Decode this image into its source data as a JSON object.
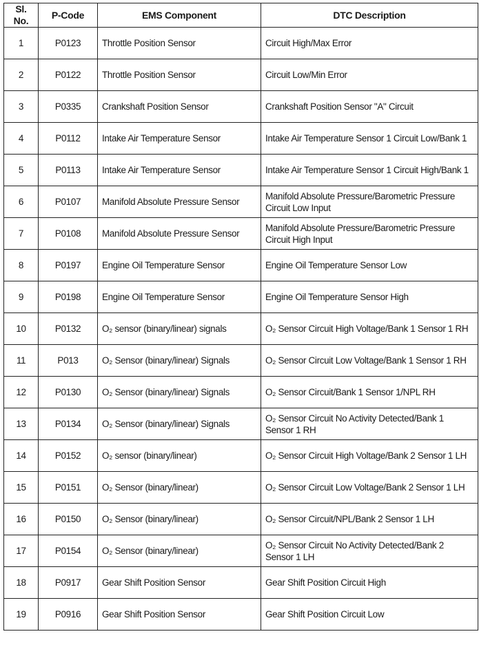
{
  "table": {
    "headers": [
      "Sl. No.",
      "P-Code",
      "EMS Component",
      "DTC Description"
    ],
    "rows": [
      {
        "no": "1",
        "code": "P0123",
        "component": "Throttle Position Sensor",
        "description": "Circuit High/Max Error"
      },
      {
        "no": "2",
        "code": "P0122",
        "component": "Throttle Position Sensor",
        "description": "Circuit Low/Min Error"
      },
      {
        "no": "3",
        "code": "P0335",
        "component": "Crankshaft Position Sensor",
        "description": "Crankshaft Position Sensor \"A\" Circuit"
      },
      {
        "no": "4",
        "code": "P0112",
        "component": "Intake Air Temperature Sensor",
        "description": "Intake Air Temperature Sensor 1 Circuit Low/Bank 1"
      },
      {
        "no": "5",
        "code": "P0113",
        "component": "Intake Air Temperature Sensor",
        "description": "Intake Air Temperature Sensor 1 Circuit High/Bank 1"
      },
      {
        "no": "6",
        "code": "P0107",
        "component": "Manifold Absolute Pressure Sensor",
        "description": "Manifold Absolute Pressure/Barometric Pressure Circuit Low Input"
      },
      {
        "no": "7",
        "code": "P0108",
        "component": "Manifold Absolute Pressure Sensor",
        "description": "Manifold Absolute Pressure/Barometric Pressure Circuit High Input"
      },
      {
        "no": "8",
        "code": "P0197",
        "component": "Engine Oil Temperature Sensor",
        "description": "Engine Oil Temperature Sensor Low"
      },
      {
        "no": "9",
        "code": "P0198",
        "component": "Engine Oil Temperature Sensor",
        "description": "Engine Oil Temperature Sensor High"
      },
      {
        "no": "10",
        "code": "P0132",
        "component": "O₂ sensor (binary/linear) signals",
        "description": "O₂ Sensor Circuit High Voltage/Bank 1 Sensor 1 RH"
      },
      {
        "no": "11",
        "code": "P013",
        "component": "O₂ Sensor (binary/linear) Signals",
        "description": "O₂ Sensor Circuit Low Voltage/Bank 1 Sensor 1 RH"
      },
      {
        "no": "12",
        "code": "P0130",
        "component": "O₂ Sensor (binary/linear) Signals",
        "description": "O₂ Sensor Circuit/Bank 1 Sensor 1/NPL RH"
      },
      {
        "no": "13",
        "code": "P0134",
        "component": "O₂ Sensor (binary/linear) Signals",
        "description": "O₂ Sensor Circuit No Activity Detected/Bank 1 Sensor 1 RH"
      },
      {
        "no": "14",
        "code": "P0152",
        "component": "O₂ sensor (binary/linear)",
        "description": "O₂ Sensor Circuit High Voltage/Bank 2 Sensor 1 LH"
      },
      {
        "no": "15",
        "code": "P0151",
        "component": "O₂  Sensor (binary/linear)",
        "description": "O₂ Sensor Circuit Low Voltage/Bank 2 Sensor 1 LH"
      },
      {
        "no": "16",
        "code": "P0150",
        "component": "O₂ Sensor (binary/linear)",
        "description": "O₂ Sensor Circuit/NPL/Bank 2 Sensor 1 LH"
      },
      {
        "no": "17",
        "code": "P0154",
        "component": "O₂ Sensor (binary/linear)",
        "description": "O₂ Sensor Circuit No Activity Detected/Bank 2 Sensor 1 LH"
      },
      {
        "no": "18",
        "code": "P0917",
        "component": "Gear Shift Position Sensor",
        "description": "Gear Shift Position Circuit High"
      },
      {
        "no": "19",
        "code": "P0916",
        "component": "Gear Shift Position Sensor",
        "description": "Gear Shift Position Circuit Low"
      }
    ]
  }
}
